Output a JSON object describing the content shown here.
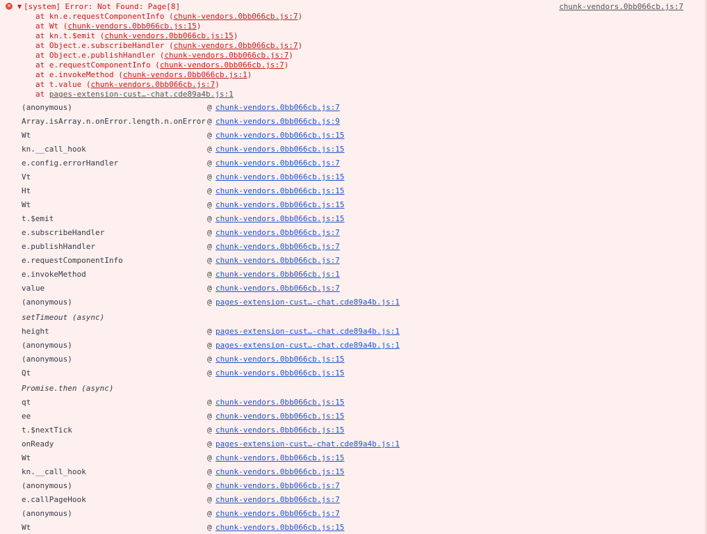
{
  "error": {
    "message": "[system] Error: Not Found: Page[8]",
    "source_link": "chunk-vendors.0bb066cb.js:7",
    "icon": "error-icon",
    "toggle_icon": "expand-triangle-icon",
    "colors": {
      "background": "#fff0f0",
      "error_text": "#c41a16",
      "link_blue": "#1a55c9",
      "icon_red": "#e8463a"
    },
    "trace": [
      {
        "at": "at kn.e.requestComponentInfo (",
        "link": "chunk-vendors.0bb066cb.js:7",
        "close": ")"
      },
      {
        "at": "at Wt (",
        "link": "chunk-vendors.0bb066cb.js:15",
        "close": ")"
      },
      {
        "at": "at kn.t.$emit (",
        "link": "chunk-vendors.0bb066cb.js:15",
        "close": ")"
      },
      {
        "at": "at Object.e.subscribeHandler (",
        "link": "chunk-vendors.0bb066cb.js:7",
        "close": ")"
      },
      {
        "at": "at Object.e.publishHandler (",
        "link": "chunk-vendors.0bb066cb.js:7",
        "close": ")"
      },
      {
        "at": "at e.requestComponentInfo (",
        "link": "chunk-vendors.0bb066cb.js:7",
        "close": ")"
      },
      {
        "at": "at e.invokeMethod (",
        "link": "chunk-vendors.0bb066cb.js:1",
        "close": ")"
      },
      {
        "at": "at t.value (",
        "link": "chunk-vendors.0bb066cb.js:7",
        "close": ")"
      },
      {
        "at": "at ",
        "link": "pages-extension-cust…-chat.cde89a4b.js:1",
        "close": ""
      }
    ]
  },
  "stack": [
    {
      "type": "frame",
      "fn": "(anonymous)",
      "at": "@",
      "url": "chunk-vendors.0bb066cb.js:7"
    },
    {
      "type": "frame",
      "fn": "Array.isArray.n.onError.length.n.onError",
      "at": "@",
      "url": "chunk-vendors.0bb066cb.js:9"
    },
    {
      "type": "frame",
      "fn": "Wt",
      "at": "@",
      "url": "chunk-vendors.0bb066cb.js:15"
    },
    {
      "type": "frame",
      "fn": "kn.__call_hook",
      "at": "@",
      "url": "chunk-vendors.0bb066cb.js:15"
    },
    {
      "type": "frame",
      "fn": "e.config.errorHandler",
      "at": "@",
      "url": "chunk-vendors.0bb066cb.js:7"
    },
    {
      "type": "frame",
      "fn": "Vt",
      "at": "@",
      "url": "chunk-vendors.0bb066cb.js:15"
    },
    {
      "type": "frame",
      "fn": "Ht",
      "at": "@",
      "url": "chunk-vendors.0bb066cb.js:15"
    },
    {
      "type": "frame",
      "fn": "Wt",
      "at": "@",
      "url": "chunk-vendors.0bb066cb.js:15"
    },
    {
      "type": "frame",
      "fn": "t.$emit",
      "at": "@",
      "url": "chunk-vendors.0bb066cb.js:15"
    },
    {
      "type": "frame",
      "fn": "e.subscribeHandler",
      "at": "@",
      "url": "chunk-vendors.0bb066cb.js:7"
    },
    {
      "type": "frame",
      "fn": "e.publishHandler",
      "at": "@",
      "url": "chunk-vendors.0bb066cb.js:7"
    },
    {
      "type": "frame",
      "fn": "e.requestComponentInfo",
      "at": "@",
      "url": "chunk-vendors.0bb066cb.js:7"
    },
    {
      "type": "frame",
      "fn": "e.invokeMethod",
      "at": "@",
      "url": "chunk-vendors.0bb066cb.js:1"
    },
    {
      "type": "frame",
      "fn": "value",
      "at": "@",
      "url": "chunk-vendors.0bb066cb.js:7"
    },
    {
      "type": "frame",
      "fn": "(anonymous)",
      "at": "@",
      "url": "pages-extension-cust…-chat.cde89a4b.js:1"
    },
    {
      "type": "async",
      "label": "setTimeout (async)"
    },
    {
      "type": "frame",
      "fn": "height",
      "at": "@",
      "url": "pages-extension-cust…-chat.cde89a4b.js:1"
    },
    {
      "type": "frame",
      "fn": "(anonymous)",
      "at": "@",
      "url": "pages-extension-cust…-chat.cde89a4b.js:1"
    },
    {
      "type": "frame",
      "fn": "(anonymous)",
      "at": "@",
      "url": "chunk-vendors.0bb066cb.js:15"
    },
    {
      "type": "frame",
      "fn": "Qt",
      "at": "@",
      "url": "chunk-vendors.0bb066cb.js:15"
    },
    {
      "type": "async",
      "label": "Promise.then (async)"
    },
    {
      "type": "frame",
      "fn": "qt",
      "at": "@",
      "url": "chunk-vendors.0bb066cb.js:15"
    },
    {
      "type": "frame",
      "fn": "ee",
      "at": "@",
      "url": "chunk-vendors.0bb066cb.js:15"
    },
    {
      "type": "frame",
      "fn": "t.$nextTick",
      "at": "@",
      "url": "chunk-vendors.0bb066cb.js:15"
    },
    {
      "type": "frame",
      "fn": "onReady",
      "at": "@",
      "url": "pages-extension-cust…-chat.cde89a4b.js:1"
    },
    {
      "type": "frame",
      "fn": "Wt",
      "at": "@",
      "url": "chunk-vendors.0bb066cb.js:15"
    },
    {
      "type": "frame",
      "fn": "kn.__call_hook",
      "at": "@",
      "url": "chunk-vendors.0bb066cb.js:15"
    },
    {
      "type": "frame",
      "fn": "(anonymous)",
      "at": "@",
      "url": "chunk-vendors.0bb066cb.js:7"
    },
    {
      "type": "frame",
      "fn": "e.callPageHook",
      "at": "@",
      "url": "chunk-vendors.0bb066cb.js:7"
    },
    {
      "type": "frame",
      "fn": "(anonymous)",
      "at": "@",
      "url": "chunk-vendors.0bb066cb.js:7"
    },
    {
      "type": "frame",
      "fn": "Wt",
      "at": "@",
      "url": "chunk-vendors.0bb066cb.js:15"
    }
  ]
}
